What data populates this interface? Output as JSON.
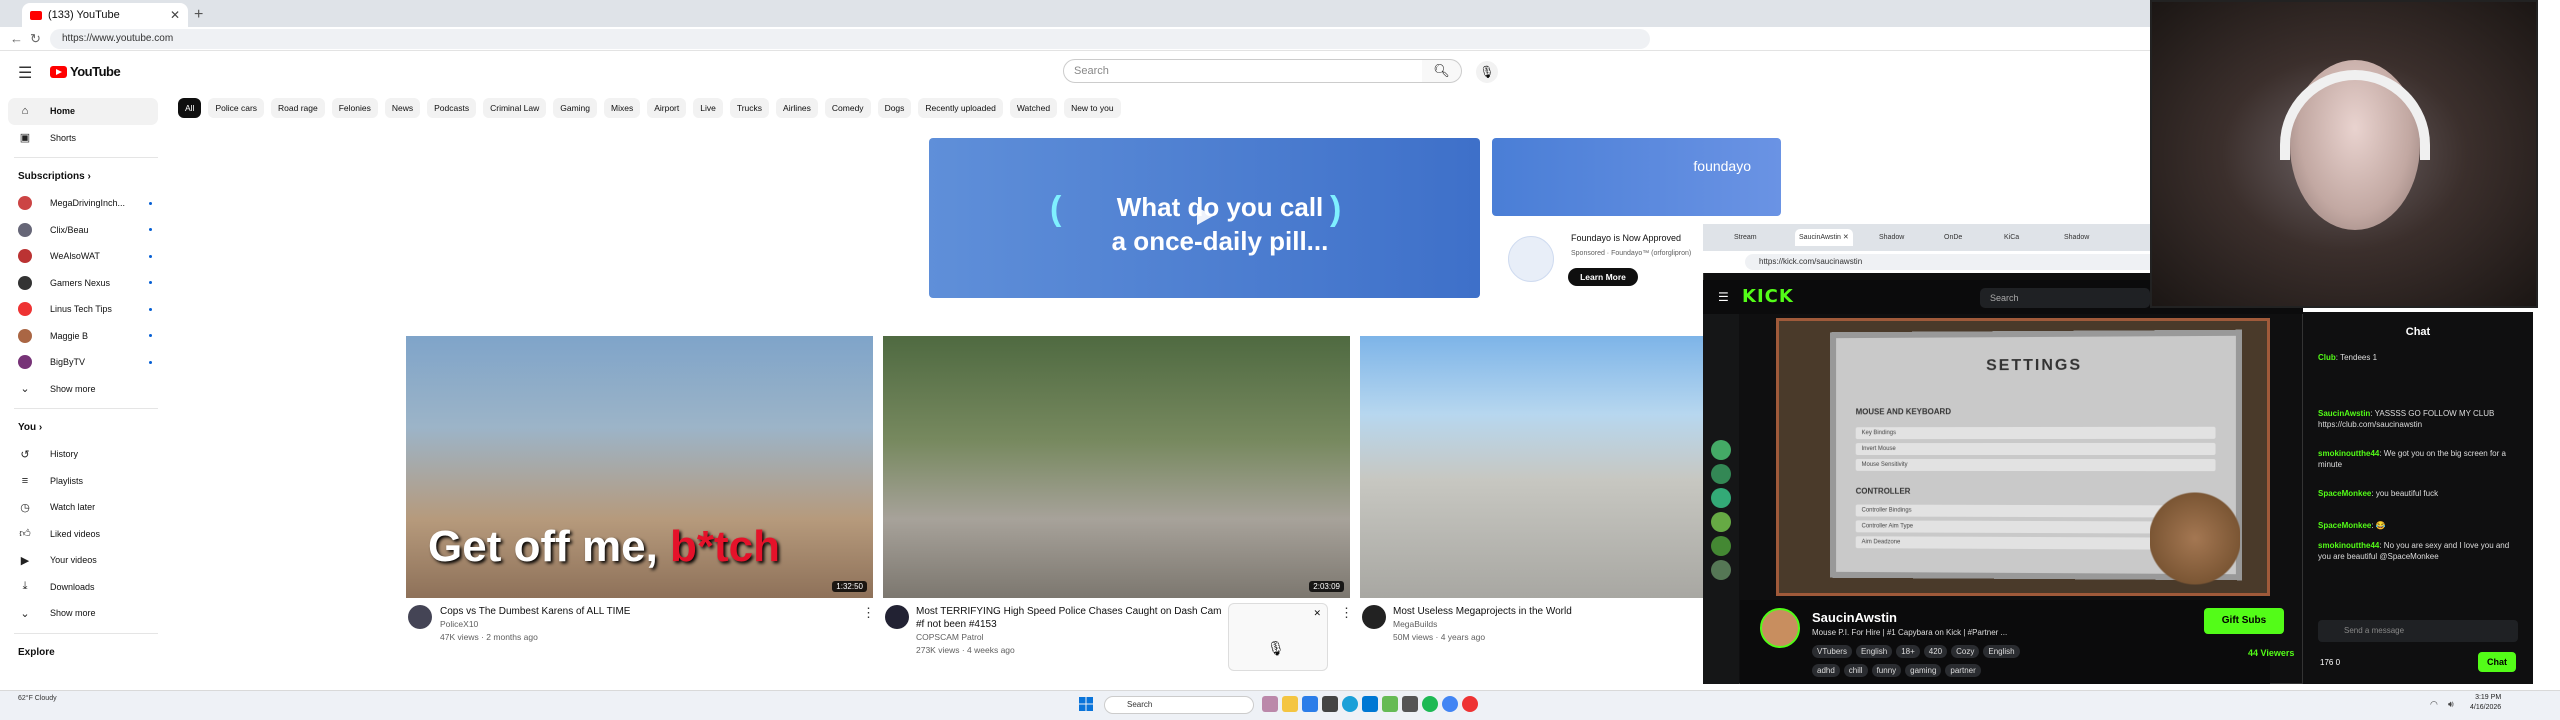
{
  "browser": {
    "tab_title": "(133) YouTube",
    "url": "https://www.youtube.com"
  },
  "yt": {
    "logo": "YouTube",
    "search_placeholder": "Search",
    "sidebar_main": [
      "Home",
      "Shorts"
    ],
    "subscriptions_label": "Subscriptions",
    "subscriptions": [
      "MegaDrivingInch...",
      "Clix/Beau",
      "WeAlsoWAT",
      "Gamers Nexus",
      "Linus Tech Tips",
      "Maggie B",
      "BigByTV"
    ],
    "show_more": "Show more",
    "you_label": "You",
    "you_items": [
      "History",
      "Playlists",
      "Watch later",
      "Liked videos",
      "Your videos",
      "Downloads",
      "Show more"
    ],
    "explore_label": "Explore",
    "chips": [
      "All",
      "Police cars",
      "Road rage",
      "Felonies",
      "News",
      "Podcasts",
      "Criminal Law",
      "Gaming",
      "Mixes",
      "Airport",
      "Live",
      "Trucks",
      "Airlines",
      "Comedy",
      "Dogs",
      "Recently uploaded",
      "Watched",
      "New to you"
    ],
    "ad": {
      "line1": "What do you call",
      "line2": "a once-daily pill...",
      "side_brand": "foundayo",
      "title": "Foundayo is Now Approved",
      "sponsor": "Sponsored · Foundayo™ (orforglipron)",
      "cta": "Learn More"
    },
    "videos": [
      {
        "title": "Cops vs The Dumbest Karens of ALL TIME",
        "channel": "PoliceX10",
        "meta": "47K views · 2 months ago",
        "overlay_a": "Get off me, ",
        "overlay_b": "b*tch",
        "duration": "1:32:50"
      },
      {
        "title": "Most TERRIFYING High Speed Police Chases Caught on Dash Cam",
        "title2": "#f not been #4153",
        "channel": "COPSCAM Patrol",
        "meta": "273K views · 4 weeks ago",
        "duration": "2:03:09"
      },
      {
        "title": "Most Useless Megaprojects in the World",
        "channel": "MegaBuilds",
        "meta": "50M views · 4 years ago"
      }
    ]
  },
  "kick": {
    "url": "https://kick.com/saucinawstin",
    "logo": "KICK",
    "search": "Search",
    "settings_title": "SETTINGS",
    "sec1": "MOUSE AND KEYBOARD",
    "sec2": "CONTROLLER",
    "rows1": [
      "Key Bindings",
      "Invert Mouse",
      "Mouse Sensitivity"
    ],
    "rows2": [
      "Controller Bindings",
      "Controller Aim Type",
      "Aim Deadzone"
    ],
    "streamer": "SaucinAwstin",
    "stream_title": "Mouse P.I. For Hire | #1 Capybara on Kick | #Partner ...",
    "tags": [
      "VTubers",
      "English",
      "18+",
      "420",
      "Cozy",
      "English"
    ],
    "tags2": [
      "adhd",
      "chill",
      "funny",
      "gaming",
      "partner"
    ],
    "gift": "Gift Subs",
    "viewers": "44 Viewers",
    "chat_title": "Chat",
    "chat": [
      {
        "u": "Club",
        "t": "Tendees  1"
      },
      {
        "u": "SaucinAwstin",
        "t": "YASSSS GO FOLLOW MY CLUB https://club.com/saucinawstin"
      },
      {
        "u": "smokinoutthe44",
        "t": "We got you on the big screen for a minute"
      },
      {
        "u": "SpaceMonkee",
        "t": "you beautiful fuck"
      },
      {
        "u": "SpaceMonkee",
        "t": "😂"
      },
      {
        "u": "smokinoutthe44",
        "t": "No you are sexy and I love you and you are beautiful @SpaceMonkee"
      }
    ],
    "chat_placeholder": "Send a message",
    "chat_btn": "Chat",
    "points": "176  0"
  },
  "taskbar": {
    "weather": "62°F Cloudy",
    "search": "Search",
    "time": "3:19 PM",
    "date": "4/16/2026"
  }
}
